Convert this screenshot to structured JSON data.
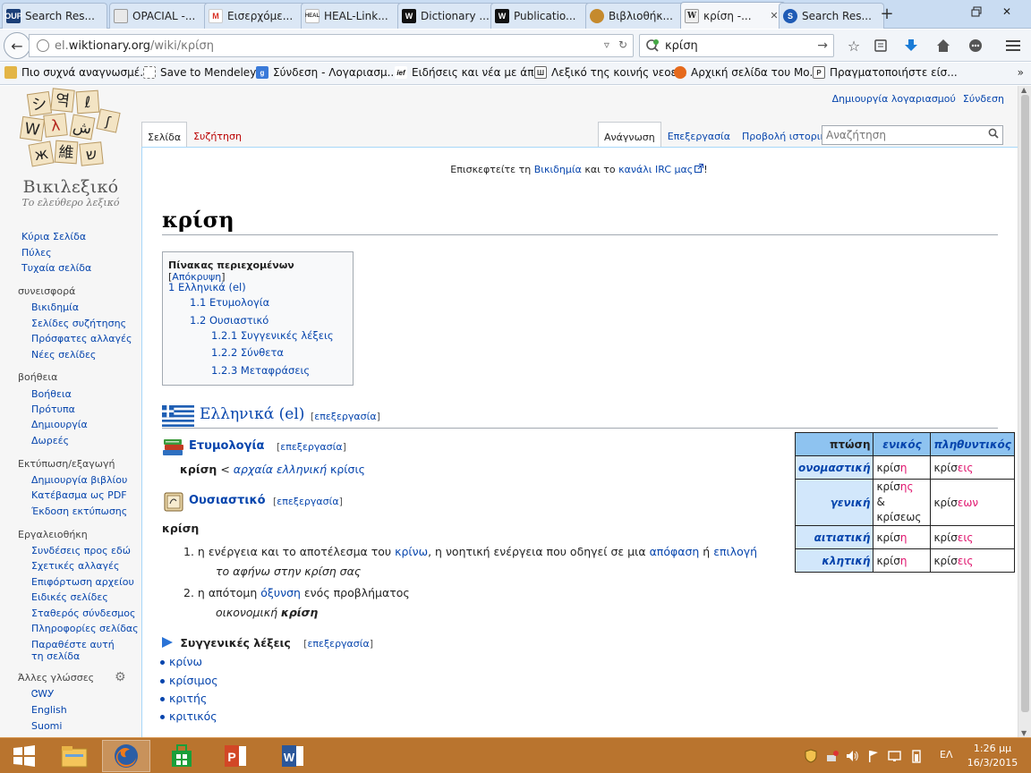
{
  "browser": {
    "tabs": [
      {
        "label": "Search Res...",
        "favicon_text": "OUP",
        "favicon_color": "#1b3f78"
      },
      {
        "label": "OPACIAL -...",
        "favicon_text": "",
        "favicon_color": "#d9d9d9"
      },
      {
        "label": "Εισερχόμε...",
        "favicon_text": "M",
        "favicon_color": "#d93025"
      },
      {
        "label": "HEAL-Link...",
        "favicon_text": "HEAL",
        "favicon_color": "#ffffff"
      },
      {
        "label": "Dictionary ...",
        "favicon_text": "W",
        "favicon_color": "#111111"
      },
      {
        "label": "Publicatio...",
        "favicon_text": "W",
        "favicon_color": "#111111"
      },
      {
        "label": "Βιβλιοθήκ...",
        "favicon_text": "",
        "favicon_color": "#c58a2d"
      },
      {
        "label": "κρίση -...",
        "favicon_text": "W",
        "favicon_color": "#e8e8e8",
        "active": true
      },
      {
        "label": "Search Res...",
        "favicon_text": "S",
        "favicon_color": "#1f5bb5"
      }
    ],
    "url_prefix": "el.",
    "url_host": "wiktionary.org",
    "url_path": "/wiki/κρίση",
    "search_value": "κρίση",
    "bookmarks": [
      {
        "label": "Πιο συχνά αναγνωσμέ...",
        "icon": "bookmark-folder-icon"
      },
      {
        "label": "Save to Mendeley",
        "icon": "mendeley-icon"
      },
      {
        "label": "Σύνδεση - Λογαριασμ...",
        "icon": "google-icon"
      },
      {
        "label": "Ειδήσεις και νέα με άπ...",
        "icon": "ief-icon"
      },
      {
        "label": "Λεξικό της κοινής νεοε...",
        "icon": "dictionary-icon"
      },
      {
        "label": "Αρχική σελίδα του Mo...",
        "icon": "firefox-icon"
      },
      {
        "label": "Πραγματοποιήστε είσ...",
        "icon": "login-icon"
      }
    ],
    "bookmarks_more": "»"
  },
  "wiki": {
    "logo_title": "Βικιλεξικό",
    "logo_subtitle": "Το ελεύθερο λεξικό",
    "logo_glyphs": [
      "シ",
      "역",
      "ℓ",
      "W",
      "λ",
      "ش",
      "ж",
      "維",
      "ש",
      "ʃ"
    ],
    "personal": {
      "create_account": "Δημιουργία λογαριασμού",
      "login": "Σύνδεση"
    },
    "tabs_left": [
      "Σελίδα",
      "Συζήτηση"
    ],
    "tabs_right": [
      "Ανάγνωση",
      "Επεξεργασία",
      "Προβολή ιστορικού"
    ],
    "search_placeholder": "Αναζήτηση",
    "nav_main": [
      "Κύρια Σελίδα",
      "Πύλες",
      "Τυχαία σελίδα"
    ],
    "sections": [
      {
        "heading": "συνεισφορά",
        "items": [
          "Βικιδημία",
          "Σελίδες συζήτησης",
          "Πρόσφατες αλλαγές",
          "Νέες σελίδες"
        ]
      },
      {
        "heading": "βοήθεια",
        "items": [
          "Βοήθεια",
          "Πρότυπα",
          "Δημιουργία",
          "Δωρεές"
        ]
      },
      {
        "heading": "Εκτύπωση/εξαγωγή",
        "items": [
          "Δημιουργία βιβλίου",
          "Κατέβασμα ως PDF",
          "Έκδοση εκτύπωσης"
        ]
      },
      {
        "heading": "Εργαλειοθήκη",
        "items": [
          "Συνδέσεις προς εδώ",
          "Σχετικές αλλαγές",
          "Επιφόρτωση αρχείου",
          "Ειδικές σελίδες",
          "Σταθερός σύνδεσμος",
          "Πληροφορίες σελίδας",
          "Παραθέστε αυτή τη σελίδα"
        ]
      }
    ],
    "languages_heading": "Άλλες γλώσσες",
    "languages": [
      "ᏣᎳᎩ",
      "English",
      "Suomi"
    ],
    "sitenotice_pre": "Επισκεφτείτε τη ",
    "sitenotice_link1": "Βικιδημία",
    "sitenotice_mid": " και το ",
    "sitenotice_link2": "κανάλι IRC μας",
    "sitenotice_post": "!",
    "title": "κρίση",
    "toc": {
      "title": "Πίνακας περιεχομένων",
      "toggle": "Απόκρυψη",
      "entries": [
        {
          "label": "1 Ελληνικά (el)",
          "level": 1
        },
        {
          "label": "1.1 Ετυμολογία",
          "level": 2
        },
        {
          "label": "1.2 Ουσιαστικό",
          "level": 2
        },
        {
          "label": "1.2.1 Συγγενικές λέξεις",
          "level": 3
        },
        {
          "label": "1.2.2 Σύνθετα",
          "level": 3
        },
        {
          "label": "1.2.3 Μεταφράσεις",
          "level": 3
        }
      ]
    },
    "edit_label": "επεξεργασία",
    "lang_heading": "Ελληνικά (el)",
    "etymology_heading": "Ετυμολογία",
    "etymology": {
      "word": "κρίση",
      "arrow": " < ",
      "link_italic": "αρχαία ελληνική",
      "link_word": "κρίσις"
    },
    "noun_heading": "Ουσιαστικό",
    "headword": "κρίση",
    "definitions": [
      {
        "num": "1.",
        "parts": [
          "η ενέργεια και το αποτέλεσμα του ",
          "κρίνω",
          ", η νοητική ενέργεια που οδηγεί σε μια ",
          "απόφαση",
          " ή ",
          "επιλογή"
        ],
        "example": "το αφήνω στην κρίση σας",
        "example_bold": ""
      },
      {
        "num": "2.",
        "parts": [
          "η απότομη ",
          "όξυνση",
          " ενός προβλήματος"
        ],
        "example": "οικονομική ",
        "example_bold": "κρίση"
      }
    ],
    "related_heading": "Συγγενικές λέξεις",
    "related": [
      "κρίνω",
      "κρίσιμος",
      "κριτής",
      "κριτικός"
    ],
    "declension": {
      "header": [
        "πτώση",
        "ενικός",
        "πληθυντικός"
      ],
      "rows": [
        {
          "case": "ονομαστική",
          "sg_stem": "κρίσ",
          "sg_suf": "η",
          "sg_alt": "",
          "pl_stem": "κρίσ",
          "pl_suf": "εις"
        },
        {
          "case": "γενική",
          "sg_stem": "κρίσ",
          "sg_suf": "ης",
          "sg_alt": "& κρίσεως",
          "pl_stem": "κρίσ",
          "pl_suf": "εων"
        },
        {
          "case": "αιτιατική",
          "sg_stem": "κρίσ",
          "sg_suf": "η",
          "sg_alt": "",
          "pl_stem": "κρίσ",
          "pl_suf": "εις"
        },
        {
          "case": "κλητική",
          "sg_stem": "κρίσ",
          "sg_suf": "η",
          "sg_alt": "",
          "pl_stem": "κρίσ",
          "pl_suf": "εις"
        }
      ]
    }
  },
  "taskbar": {
    "language": "ΕΛ",
    "time": "1:26 μμ",
    "date": "16/3/2015"
  },
  "colors": {
    "link": "#0645ad",
    "suffix": "#e0156e",
    "table_head": "#8ec3f0",
    "taskbar": "#b9742e"
  }
}
